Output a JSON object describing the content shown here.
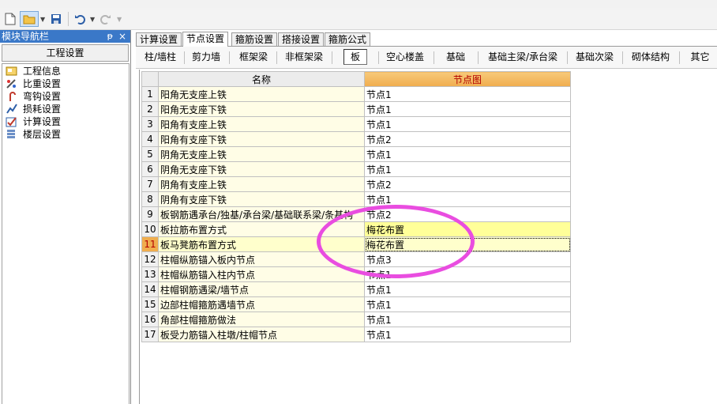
{
  "nav": {
    "title": "模块导航栏",
    "pin": "ᵽ",
    "close": "×",
    "header": "工程设置",
    "items": [
      {
        "label": "工程信息",
        "icon": "project-info-icon"
      },
      {
        "label": "比重设置",
        "icon": "weight-settings-icon"
      },
      {
        "label": "弯钩设置",
        "icon": "hook-settings-icon"
      },
      {
        "label": "损耗设置",
        "icon": "loss-settings-icon"
      },
      {
        "label": "计算设置",
        "icon": "calc-settings-icon"
      },
      {
        "label": "楼层设置",
        "icon": "floor-settings-icon"
      }
    ]
  },
  "tabs": [
    "计算设置",
    "节点设置",
    "箍筋设置",
    "搭接设置",
    "箍筋公式"
  ],
  "active_tab": "节点设置",
  "subtabs": [
    "柱/墙柱",
    "剪力墙",
    "框架梁",
    "非框架梁",
    "板",
    "空心楼盖",
    "基础",
    "基础主梁/承台梁",
    "基础次梁",
    "砌体结构",
    "其它"
  ],
  "active_subtab": "板",
  "grid": {
    "col_name": "名称",
    "col_node": "节点图",
    "rows": [
      {
        "num": "1",
        "name": "阳角无支座上铁",
        "value": "节点1"
      },
      {
        "num": "2",
        "name": "阳角无支座下铁",
        "value": "节点1"
      },
      {
        "num": "3",
        "name": "阳角有支座上铁",
        "value": "节点1"
      },
      {
        "num": "4",
        "name": "阳角有支座下铁",
        "value": "节点2"
      },
      {
        "num": "5",
        "name": "阴角无支座上铁",
        "value": "节点1"
      },
      {
        "num": "6",
        "name": "阴角无支座下铁",
        "value": "节点1"
      },
      {
        "num": "7",
        "name": "阴角有支座上铁",
        "value": "节点2"
      },
      {
        "num": "8",
        "name": "阴角有支座下铁",
        "value": "节点1"
      },
      {
        "num": "9",
        "name": "板钢筋遇承台/独基/承台梁/基础联系梁/条基构",
        "value": "节点2"
      },
      {
        "num": "10",
        "name": "板拉筋布置方式",
        "value": "梅花布置"
      },
      {
        "num": "11",
        "name": "板马凳筋布置方式",
        "value": "梅花布置"
      },
      {
        "num": "12",
        "name": "柱帽纵筋锚入板内节点",
        "value": "节点3"
      },
      {
        "num": "13",
        "name": "柱帽纵筋锚入柱内节点",
        "value": "节点1"
      },
      {
        "num": "14",
        "name": "柱帽钢筋遇梁/墙节点",
        "value": "节点1"
      },
      {
        "num": "15",
        "name": "边部柱帽箍筋遇墙节点",
        "value": "节点1"
      },
      {
        "num": "16",
        "name": "角部柱帽箍筋做法",
        "value": "节点1"
      },
      {
        "num": "17",
        "name": "板受力筋锚入柱墩/柱帽节点",
        "value": "节点1"
      }
    ],
    "selected_row": "11",
    "highlighted_row": "10"
  },
  "colors": {
    "nav_title_bg": "#3a78c8",
    "header_orange": "#f0ad4e",
    "name_bg": "#fffde6",
    "highlight_yellow": "#ffff99",
    "annotation_magenta": "#e94de0"
  }
}
